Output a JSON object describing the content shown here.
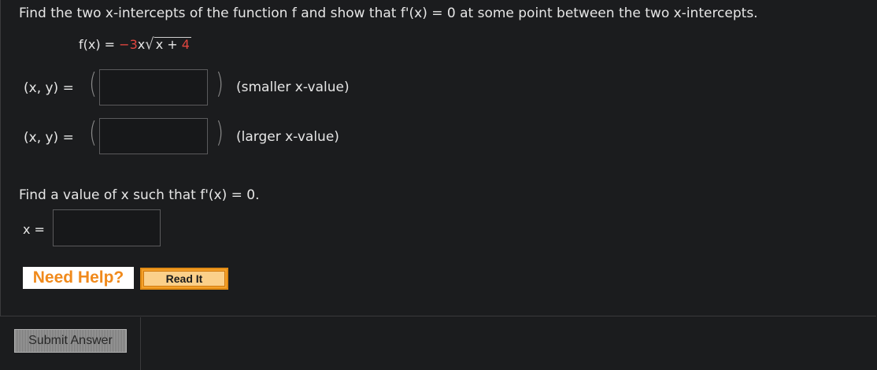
{
  "question": {
    "prompt": "Find the two x-intercepts of the function f and show that  f'(x) = 0  at some point between the two x-intercepts.",
    "function_lhs": "f(x) = ",
    "function_coef": "−3",
    "function_x": "x",
    "radicand_x": "x + ",
    "radicand_const": "4"
  },
  "intercepts": [
    {
      "label": "(x, y)  =",
      "value": "",
      "note": "(smaller x-value)"
    },
    {
      "label": "(x, y)  =",
      "value": "",
      "note": "(larger x-value)"
    }
  ],
  "part2": {
    "prompt": "Find a value of x such that  f'(x) = 0.",
    "x_label": "x =",
    "x_value": ""
  },
  "help": {
    "need_help": "Need Help?",
    "read_it": "Read It"
  },
  "submit_label": "Submit Answer",
  "colors": {
    "background": "#1b1c1e",
    "highlight_red": "#e2463f",
    "help_orange": "#f08a1c",
    "read_it_orange": "#f4a12a"
  }
}
